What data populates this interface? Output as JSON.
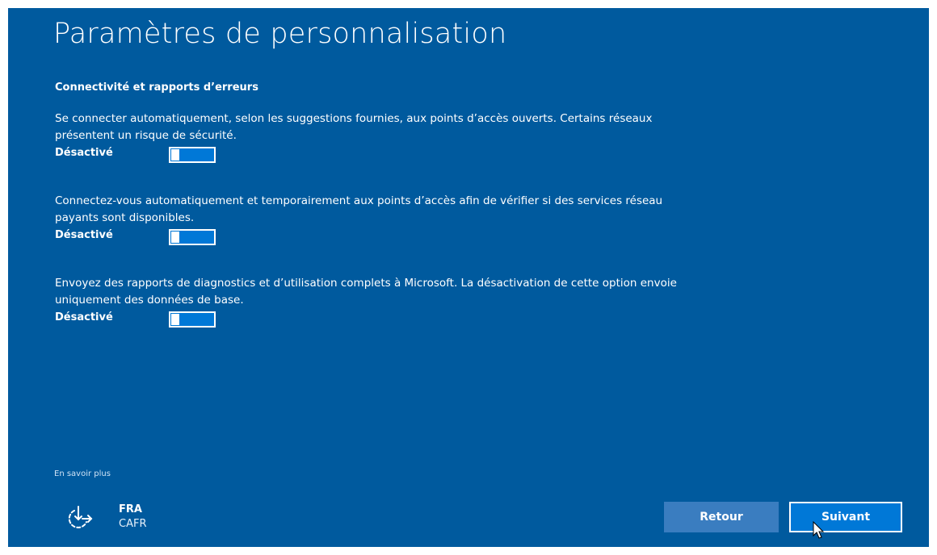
{
  "page": {
    "title": "Paramètres de personnalisation",
    "section_heading": "Connectivité et rapports d’erreurs"
  },
  "settings": [
    {
      "description": "Se connecter automatiquement, selon les suggestions fournies, aux points d’accès ouverts. Certains réseaux présentent un risque de sécurité.",
      "state": "Désactivé",
      "on": false
    },
    {
      "description": "Connectez-vous automatiquement et temporairement aux points d’accès afin de vérifier si des services réseau payants sont disponibles.",
      "state": "Désactivé",
      "on": false
    },
    {
      "description": "Envoyez des rapports de diagnostics et d’utilisation complets à Microsoft. La désactivation de cette option envoie uniquement des données de base.",
      "state": "Désactivé",
      "on": false
    }
  ],
  "footer": {
    "learn_more": "En savoir plus",
    "ease_of_access_icon": "ease-of-access-icon",
    "language_code": "FRA",
    "keyboard_layout": "CAFR",
    "back_button": "Retour",
    "next_button": "Suivant"
  },
  "colors": {
    "background": "#005a9e",
    "toggle_fill": "#0078d7",
    "back_button": "#3a7dc0",
    "next_button": "#0078d7"
  }
}
